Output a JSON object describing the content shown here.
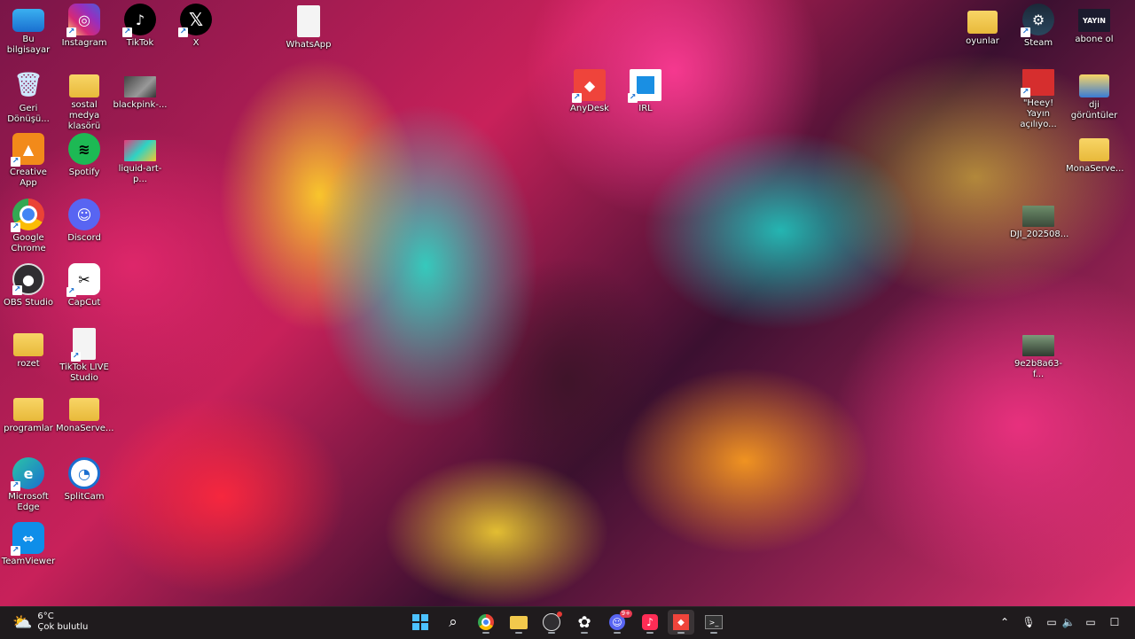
{
  "desktop": {
    "icons": [
      {
        "label": "Bu bilgisayar",
        "icon": "computer-icon",
        "shortcut": false
      },
      {
        "label": "Instagram",
        "icon": "instagram-icon",
        "shortcut": true
      },
      {
        "label": "TikTok",
        "icon": "tiktok-icon",
        "shortcut": true
      },
      {
        "label": "X",
        "icon": "x-icon",
        "shortcut": true
      },
      {
        "label": "WhatsApp",
        "icon": "whatsapp-file-icon",
        "shortcut": false
      },
      {
        "label": "Geri\nDönüşü...",
        "icon": "recycle-bin-icon",
        "shortcut": false
      },
      {
        "label": "sostal medya\nklasörü",
        "icon": "folder-icon",
        "shortcut": false
      },
      {
        "label": "blackpink-...",
        "icon": "image-file-icon",
        "shortcut": false
      },
      {
        "label": "AnyDesk",
        "icon": "anydesk-icon",
        "shortcut": true
      },
      {
        "label": "IRL",
        "icon": "irl-icon",
        "shortcut": true
      },
      {
        "label": "Creative App",
        "icon": "creative-app-icon",
        "shortcut": true
      },
      {
        "label": "Spotify",
        "icon": "spotify-icon",
        "shortcut": false
      },
      {
        "label": "liquid-art-p...",
        "icon": "image-file-icon",
        "shortcut": false
      },
      {
        "label": "Google\nChrome",
        "icon": "chrome-icon",
        "shortcut": true
      },
      {
        "label": "Discord",
        "icon": "discord-icon",
        "shortcut": false
      },
      {
        "label": "OBS Studio",
        "icon": "obs-icon",
        "shortcut": true
      },
      {
        "label": "CapCut",
        "icon": "capcut-icon",
        "shortcut": true
      },
      {
        "label": "rozet",
        "icon": "folder-icon",
        "shortcut": false
      },
      {
        "label": "TikTok LIVE\nStudio",
        "icon": "file-icon",
        "shortcut": true
      },
      {
        "label": "programlar",
        "icon": "folder-icon",
        "shortcut": false
      },
      {
        "label": "MonaServe...",
        "icon": "folder-icon",
        "shortcut": false
      },
      {
        "label": "Microsoft\nEdge",
        "icon": "edge-icon",
        "shortcut": true
      },
      {
        "label": "SplitCam",
        "icon": "splitcam-icon",
        "shortcut": false
      },
      {
        "label": "TeamViewer",
        "icon": "teamviewer-icon",
        "shortcut": true
      },
      {
        "label": "oyunlar",
        "icon": "folder-icon",
        "shortcut": false
      },
      {
        "label": "Steam",
        "icon": "steam-icon",
        "shortcut": true
      },
      {
        "label": "abone ol",
        "icon": "yayin-image-icon",
        "shortcut": false
      },
      {
        "label": "\"Heey!\nYayın açılıyo...",
        "icon": "red-image-icon",
        "shortcut": true
      },
      {
        "label": "dji görüntüler",
        "icon": "folder-icon",
        "shortcut": false
      },
      {
        "label": "MonaServe...",
        "icon": "folder-icon",
        "shortcut": false
      },
      {
        "label": "DJI_202508...",
        "icon": "image-file-icon",
        "shortcut": false
      },
      {
        "label": "9e2b8a63-f...",
        "icon": "image-file-icon",
        "shortcut": false
      }
    ],
    "yayin_text": "YAYIN"
  },
  "taskbar": {
    "weather": {
      "temp": "6°C",
      "condition": "Çok bulutlu",
      "icon": "cloudy-weather-icon"
    },
    "apps": [
      {
        "name": "start",
        "icon": "windows-start-icon"
      },
      {
        "name": "search",
        "icon": "search-icon"
      },
      {
        "name": "chrome",
        "icon": "chrome-icon"
      },
      {
        "name": "file-explorer",
        "icon": "folder-icon"
      },
      {
        "name": "obs",
        "icon": "obs-icon"
      },
      {
        "name": "chatgpt",
        "icon": "chatgpt-icon"
      },
      {
        "name": "discord",
        "icon": "discord-icon"
      },
      {
        "name": "tiktok",
        "icon": "tiktok-icon"
      },
      {
        "name": "anydesk",
        "icon": "anydesk-icon"
      },
      {
        "name": "terminal",
        "icon": "terminal-icon"
      }
    ],
    "discord_badge": "9+",
    "tray": [
      "chevron-up-icon",
      "microphone-icon",
      "display-icon",
      "speaker-icon",
      "battery-icon",
      "notification-icon"
    ]
  },
  "colors": {
    "taskbar_bg": "#1f1b1d",
    "folder": "#f2c94c",
    "anydesk": "#ef443b",
    "discord": "#5865f2",
    "spotify": "#1db954"
  }
}
